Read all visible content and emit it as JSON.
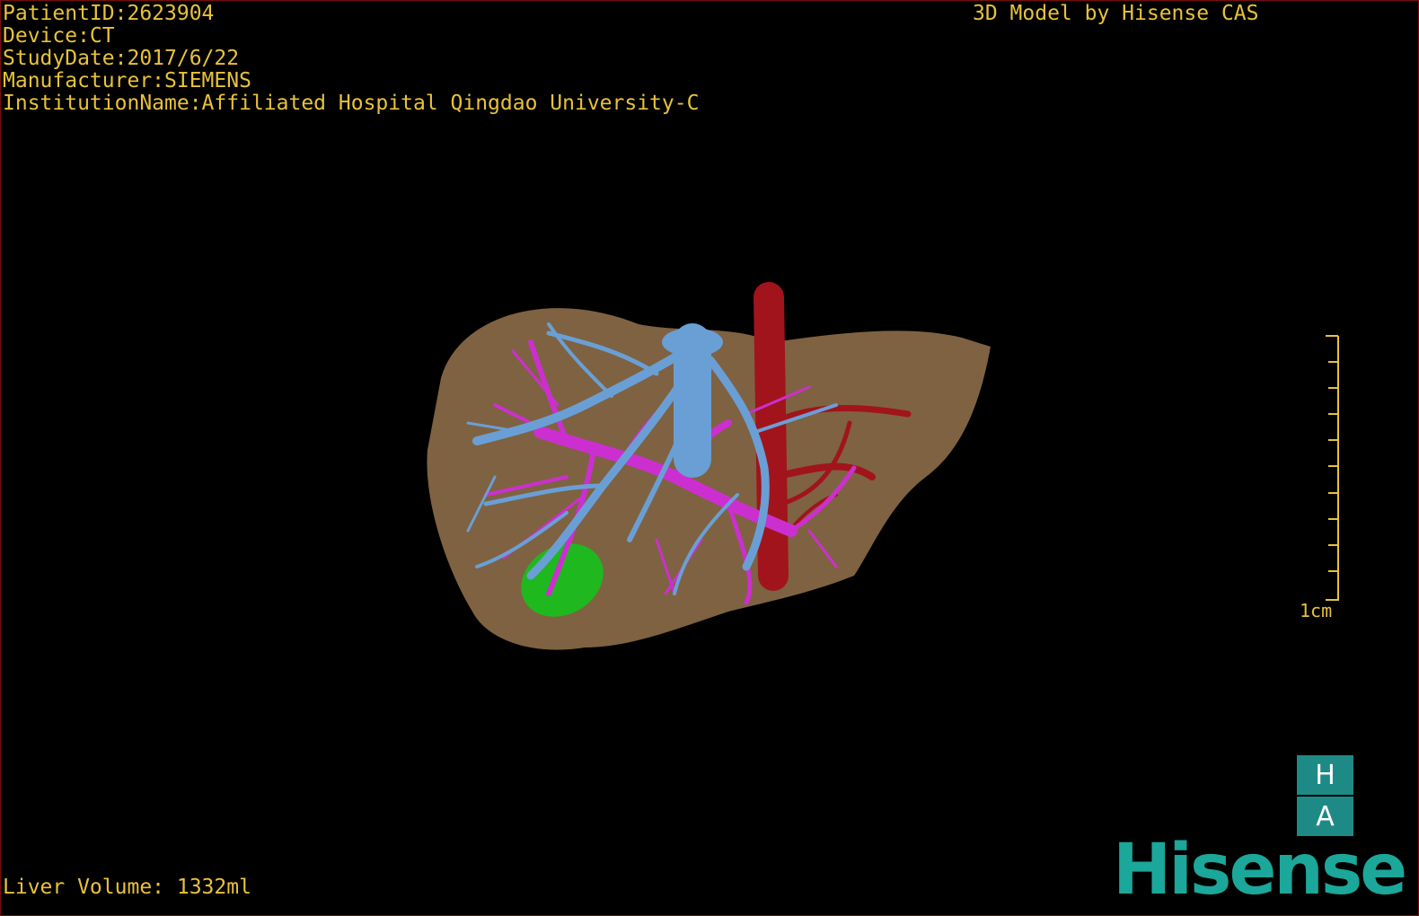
{
  "overlay": {
    "patient_id": "PatientID:2623904",
    "device": "Device:CT",
    "study_date": "StudyDate:2017/6/22",
    "manufacturer": "Manufacturer:SIEMENS",
    "institution": "InstitutionName:Affiliated Hospital Qingdao University-C",
    "model_credit": "3D Model by Hisense CAS",
    "liver_volume": "Liver Volume: 1332ml"
  },
  "scale": {
    "label": "1cm"
  },
  "orientation": {
    "top": "H",
    "bottom": "A"
  },
  "brand": {
    "logo_text": "Hisense"
  },
  "colors": {
    "text": "#e8c23a",
    "liver": "#8a6a46",
    "hepatic_vein": "#6a9fd6",
    "portal_vein": "#cc2fcf",
    "artery": "#a1141c",
    "gallbladder": "#1fb81f",
    "brand": "#1ba79a"
  }
}
